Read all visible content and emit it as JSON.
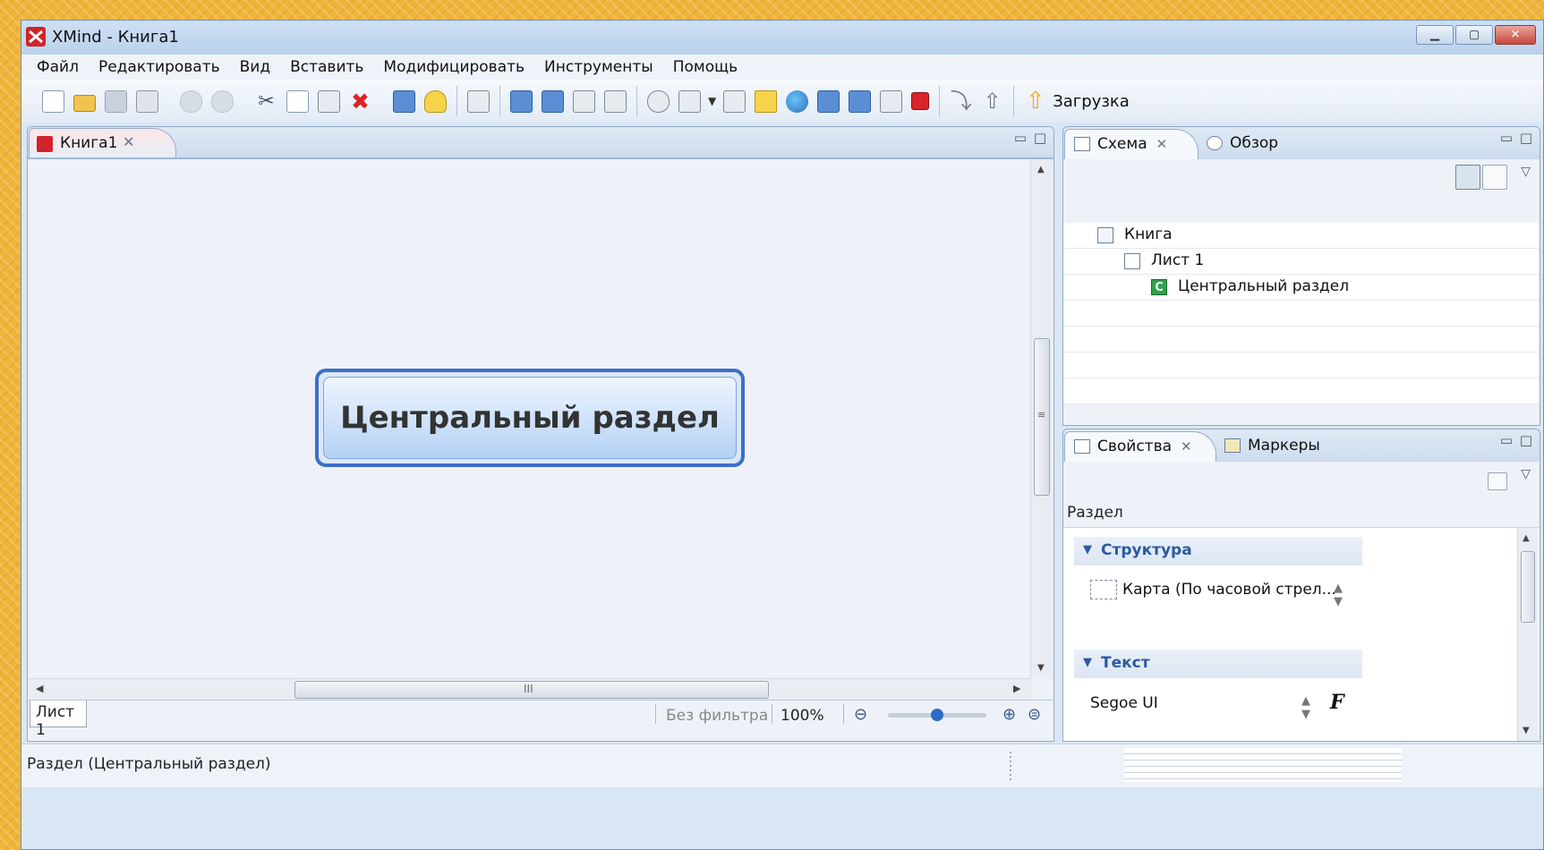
{
  "window": {
    "title": "XMind - Книга1",
    "min_label": "▁",
    "max_label": "▢",
    "close_label": "✕"
  },
  "menu": [
    "Файл",
    "Редактировать",
    "Вид",
    "Вставить",
    "Модифицировать",
    "Инструменты",
    "Помощь"
  ],
  "toolbar": {
    "upload_label": "Загрузка",
    "icons": [
      "new-icon",
      "open-icon",
      "save-icon",
      "print-icon",
      "undo-icon",
      "redo-icon",
      "cut-icon",
      "copy-icon",
      "paste-icon",
      "delete-icon",
      "presentation-icon",
      "idea-icon",
      "drill-down-icon",
      "insert-topic-icon",
      "insert-subtopic-icon",
      "insert-before-icon",
      "insert-parent-icon",
      "attachment-icon",
      "image-icon",
      "relationship-icon",
      "note-icon",
      "hyperlink-icon",
      "boundary-icon",
      "summary-icon",
      "label-icon",
      "stop-icon",
      "move-down-icon",
      "move-up-icon",
      "upload-icon"
    ]
  },
  "editor": {
    "tab_label": "Книга1",
    "tab_close": "✕",
    "central_topic": "Центральный раздел",
    "sheet_tab": "Лист 1",
    "filter_label": "Без фильтра",
    "zoom": "100%",
    "zoom_out": "⊖",
    "zoom_in": "⊕",
    "zoom_fit": "⊜",
    "hscroll_grip": "III",
    "vscroll_grip": "≡"
  },
  "outline": {
    "tabs": [
      {
        "label": "Схема",
        "close": "✕"
      },
      {
        "label": "Обзор"
      }
    ],
    "tree": [
      {
        "label": "Книга",
        "level": 0,
        "type": "book"
      },
      {
        "label": "Лист 1",
        "level": 1,
        "type": "sheet"
      },
      {
        "label": "Центральный раздел",
        "level": 2,
        "type": "topic",
        "icon_text": "C"
      }
    ]
  },
  "properties": {
    "tabs": [
      {
        "label": "Свойства",
        "close": "✕"
      },
      {
        "label": "Маркеры"
      }
    ],
    "header": "Раздел",
    "structure_section": "Структура",
    "structure_value": "Карта (По часовой стрел...",
    "text_section": "Текст",
    "font_value": "Segoe UI",
    "font_button": "F"
  },
  "status": {
    "text": "Раздел (Центральный раздел)"
  },
  "colors": {
    "accent": "#3c6fc9",
    "brand": "#d1232b",
    "section_title": "#2c5aa0"
  }
}
